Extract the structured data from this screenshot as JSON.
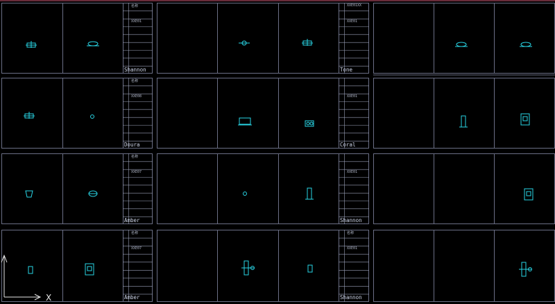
{
  "colors": {
    "background": "#000000",
    "frame": "#6b6f86",
    "frame_light": "#9aa0b8",
    "symbol": "#29d6e6",
    "accent_top": "#6a2c3a",
    "axis": "#e6e6e6"
  },
  "ucs": {
    "axis_label": "X"
  },
  "title_blocks": [
    {
      "name": "tb-r1c1",
      "top": "名称",
      "code": "XXE01",
      "bottom": "Shannon"
    },
    {
      "name": "tb-r1c2",
      "top": "XXE01XX",
      "code": "XXE01",
      "bottom": "Tone"
    },
    {
      "name": "tb-r2c1",
      "top": "名称",
      "code": "XXE08",
      "bottom": "Doura"
    },
    {
      "name": "tb-r2c2",
      "top": "",
      "code": "XXE01",
      "bottom": "Coral"
    },
    {
      "name": "tb-r3c1",
      "top": "名称",
      "code": "XXE07",
      "bottom": "Amber"
    },
    {
      "name": "tb-r3c2",
      "top": "",
      "code": "XXE01",
      "bottom": "Shannon"
    },
    {
      "name": "tb-r4c1",
      "top": "名称",
      "code": "XXE07",
      "bottom": "Amber"
    },
    {
      "name": "tb-r4c2",
      "top": "名称",
      "code": "XXE01",
      "bottom": "Shannon"
    }
  ],
  "symbols": [
    {
      "name": "faucet-symbol",
      "kind": "faucet"
    },
    {
      "name": "basin-symbol",
      "kind": "basin"
    },
    {
      "name": "valve-symbol",
      "kind": "valve"
    },
    {
      "name": "faucet-symbol",
      "kind": "faucet"
    },
    {
      "name": "basin-symbol",
      "kind": "basin"
    },
    {
      "name": "basin-symbol",
      "kind": "basin"
    },
    {
      "name": "faucet-symbol",
      "kind": "faucet"
    },
    {
      "name": "dot-symbol",
      "kind": "dot"
    },
    {
      "name": "tub-symbol",
      "kind": "tub"
    },
    {
      "name": "pump-symbol",
      "kind": "pump"
    },
    {
      "name": "vertical-fixture-symbol",
      "kind": "vertical"
    },
    {
      "name": "panel-symbol",
      "kind": "panel"
    },
    {
      "name": "cup-symbol",
      "kind": "cup"
    },
    {
      "name": "bowl-symbol",
      "kind": "bowl"
    },
    {
      "name": "dot-symbol",
      "kind": "dot"
    },
    {
      "name": "vertical-fixture-symbol",
      "kind": "vertical"
    },
    {
      "name": "panel-symbol",
      "kind": "panel"
    },
    {
      "name": "small-fixture-symbol",
      "kind": "small"
    },
    {
      "name": "panel-symbol",
      "kind": "panel"
    },
    {
      "name": "pipe-assembly-symbol",
      "kind": "pipe"
    }
  ]
}
